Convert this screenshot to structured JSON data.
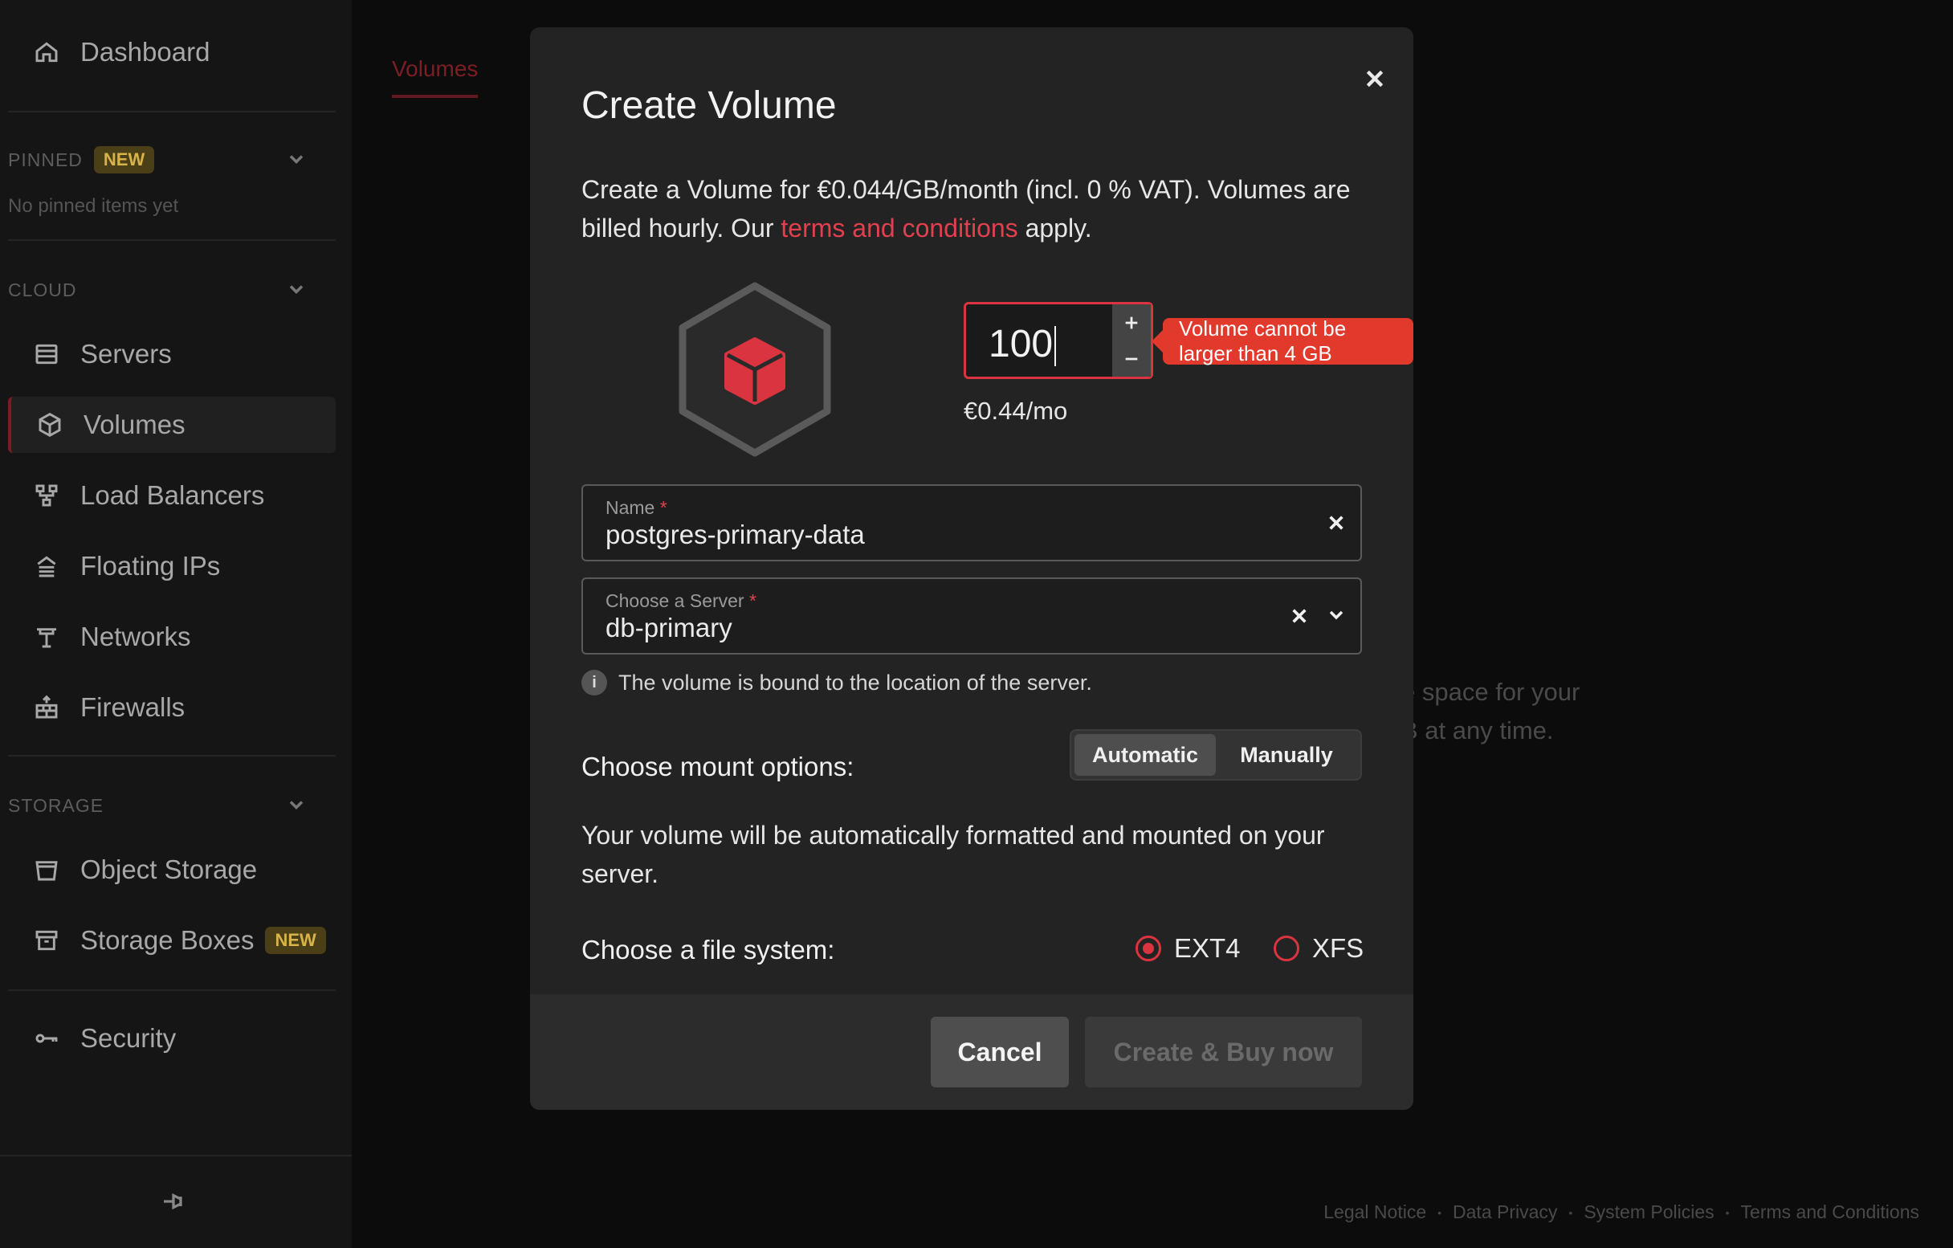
{
  "sidebar": {
    "dashboard": "Dashboard",
    "pinned_label": "PINNED",
    "pinned_badge": "NEW",
    "pinned_empty": "No pinned items yet",
    "cloud_label": "CLOUD",
    "storage_label": "STORAGE",
    "items": {
      "servers": "Servers",
      "volumes": "Volumes",
      "load_balancers": "Load Balancers",
      "floating_ips": "Floating IPs",
      "networks": "Networks",
      "firewalls": "Firewalls",
      "object_storage": "Object Storage",
      "storage_boxes": "Storage Boxes",
      "storage_boxes_badge": "NEW",
      "security": "Security"
    }
  },
  "main": {
    "tab": "Volumes",
    "bg_text_line1": "e space for your",
    "bg_text_line2": "B at any time."
  },
  "footer": {
    "links": [
      "Legal Notice",
      "Data Privacy",
      "System Policies",
      "Terms and Conditions"
    ]
  },
  "modal": {
    "title": "Create Volume",
    "desc_before": "Create a Volume for €0.044/GB/month (incl. 0 % VAT). Volumes are billed hourly. Our ",
    "desc_link": "terms and conditions",
    "desc_after": " apply.",
    "size_value": "100",
    "size_error": "Volume cannot be larger than 4 GB",
    "price": "€0.44/mo",
    "name_label": "Name",
    "name_value": "postgres-primary-data",
    "server_label": "Choose a Server",
    "server_value": "db-primary",
    "required_mark": "*",
    "info_text": "The volume is bound to the location of the server.",
    "mount_label": "Choose mount options:",
    "mount_options": [
      "Automatic",
      "Manually"
    ],
    "mount_selected": "Automatic",
    "mount_desc": "Your volume will be automatically formatted and mounted on your server.",
    "fs_label": "Choose a file system:",
    "fs_options": [
      "EXT4",
      "XFS"
    ],
    "fs_selected": "EXT4",
    "cancel": "Cancel",
    "create": "Create & Buy now"
  },
  "colors": {
    "accent": "#d9343f",
    "error": "#e1392c",
    "link": "#e2404e",
    "badge_bg": "#4b3f17",
    "badge_fg": "#d8b34a"
  }
}
